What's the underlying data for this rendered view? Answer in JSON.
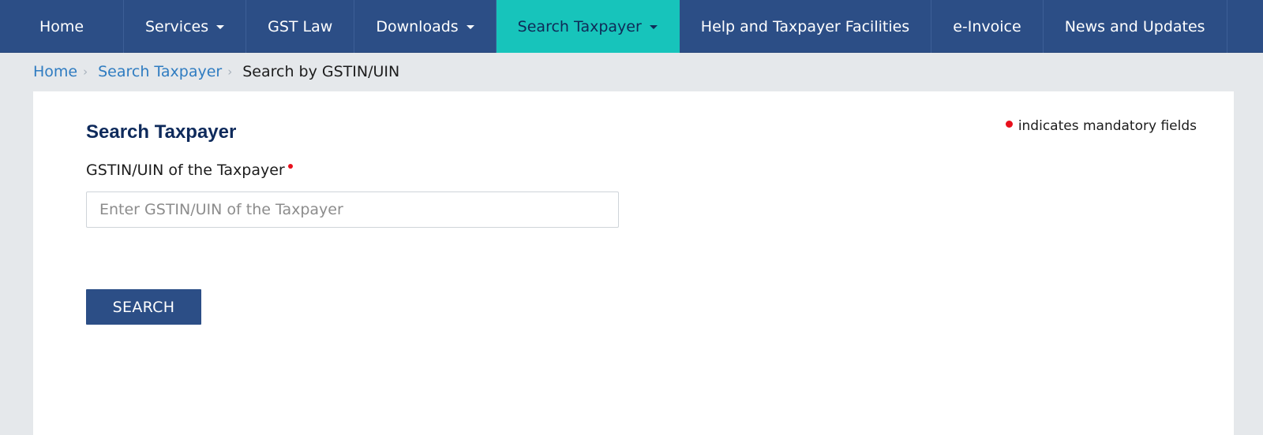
{
  "nav": {
    "items": [
      {
        "label": "Home",
        "dropdown": false,
        "active": false
      },
      {
        "label": "Services",
        "dropdown": true,
        "active": false
      },
      {
        "label": "GST Law",
        "dropdown": false,
        "active": false
      },
      {
        "label": "Downloads",
        "dropdown": true,
        "active": false
      },
      {
        "label": "Search Taxpayer",
        "dropdown": true,
        "active": true
      },
      {
        "label": "Help and Taxpayer Facilities",
        "dropdown": false,
        "active": false
      },
      {
        "label": "e-Invoice",
        "dropdown": false,
        "active": false
      },
      {
        "label": "News and Updates",
        "dropdown": false,
        "active": false
      }
    ]
  },
  "breadcrumb": {
    "home": "Home",
    "section": "Search Taxpayer",
    "current": "Search by GSTIN/UIN"
  },
  "form": {
    "title": "Search Taxpayer",
    "mandatory_note": "indicates mandatory fields",
    "gstin_label": "GSTIN/UIN of the Taxpayer",
    "gstin_placeholder": "Enter GSTIN/UIN of the Taxpayer",
    "gstin_value": "",
    "search_label": "SEARCH"
  },
  "colors": {
    "nav_bg": "#2c4e86",
    "nav_active": "#17c4bb",
    "link": "#2f7cc1",
    "required": "#e8101c",
    "button_bg": "#2c4e86"
  }
}
